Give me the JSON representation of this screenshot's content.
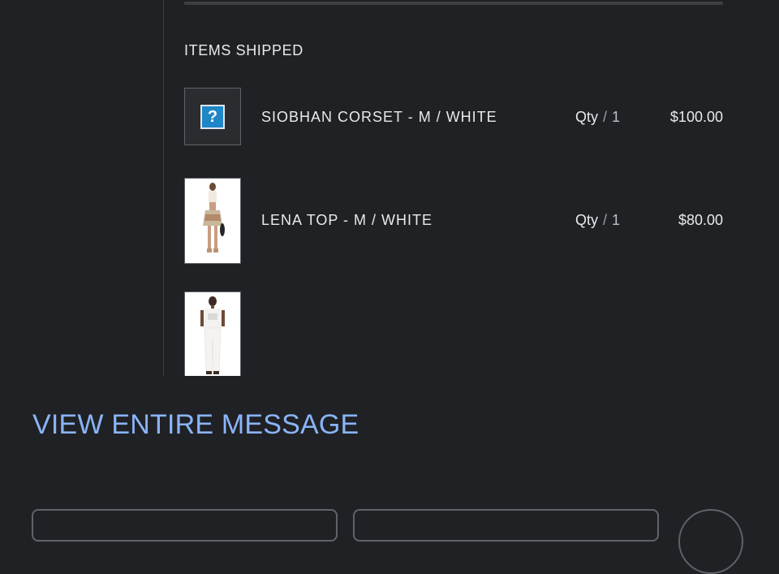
{
  "section": {
    "title": "ITEMS SHIPPED"
  },
  "items": [
    {
      "name": "SIOBHAN CORSET - M / WHITE",
      "qty_label": "Qty",
      "qty_sep": "/",
      "qty": "1",
      "price": "$100.00",
      "image": "missing-image-icon"
    },
    {
      "name": "LENA TOP - M / WHITE",
      "qty_label": "Qty",
      "qty_sep": "/",
      "qty": "1",
      "price": "$80.00",
      "image": "product-photo"
    },
    {
      "name": "",
      "qty_label": "",
      "qty_sep": "",
      "qty": "",
      "price": "",
      "image": "product-photo"
    }
  ],
  "link": {
    "view_entire_message": "VIEW ENTIRE MESSAGE"
  },
  "colors": {
    "background": "#202124",
    "text": "#e8eaed",
    "link": "#8ab4f8",
    "border": "#5f6368"
  }
}
